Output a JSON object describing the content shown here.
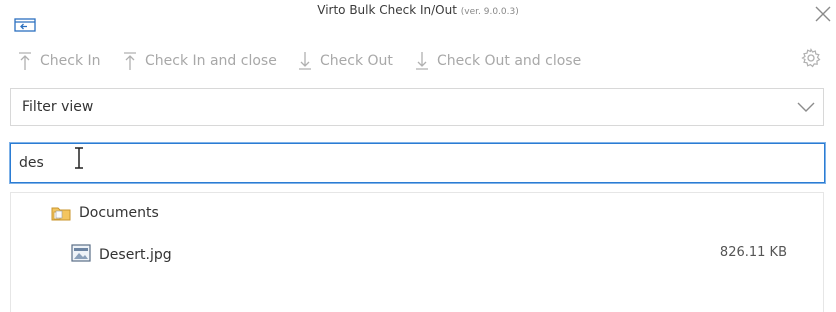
{
  "window": {
    "title": "Virto Bulk Check In/Out",
    "version": "(ver. 9.0.0.3)"
  },
  "toolbar": {
    "check_in": "Check In",
    "check_in_close": "Check In and close",
    "check_out": "Check Out",
    "check_out_close": "Check Out and close"
  },
  "filter": {
    "selected": "Filter view"
  },
  "search": {
    "value": "des"
  },
  "tree": {
    "folder": {
      "label": "Documents",
      "icon": "folder-icon"
    },
    "file": {
      "label": "Desert.jpg",
      "size": "826.11 KB",
      "icon": "image-file-icon"
    }
  },
  "colors": {
    "accent": "#2b7cd3",
    "disabled_text": "#a8a8a8",
    "folder": "#e8b64a"
  }
}
